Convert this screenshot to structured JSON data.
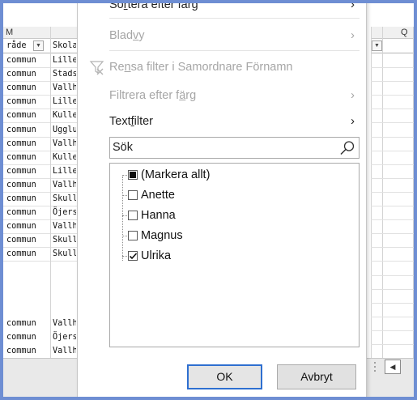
{
  "sheet": {
    "col_letters": {
      "left": "M",
      "right": "Q"
    },
    "header": {
      "col1": "råde",
      "col2": "Skola/"
    },
    "rows": [
      {
        "c1": "commun",
        "c2": "Lillegå"
      },
      {
        "c1": "commun",
        "c2": "Stadsp"
      },
      {
        "c1": "commun",
        "c2": "Vallha"
      },
      {
        "c1": "commun",
        "c2": "Lillegå"
      },
      {
        "c1": "commun",
        "c2": "Kulleg"
      },
      {
        "c1": "commun",
        "c2": "Ugglur"
      },
      {
        "c1": "commun",
        "c2": "Vallha"
      },
      {
        "c1": "commun",
        "c2": "Kulleg"
      },
      {
        "c1": "commun",
        "c2": "Lillegå"
      },
      {
        "c1": "commun",
        "c2": "Vallha"
      },
      {
        "c1": "commun",
        "c2": "Skulltc"
      },
      {
        "c1": "commun",
        "c2": "Öjersjo"
      },
      {
        "c1": "commun",
        "c2": "Vallha"
      },
      {
        "c1": "commun",
        "c2": "Skulltc"
      },
      {
        "c1": "commun",
        "c2": "Skulltc"
      }
    ],
    "bottom_rows": [
      {
        "c1": "commun",
        "c2": "Vallha"
      },
      {
        "c1": "commun",
        "c2": "Öjersjo"
      },
      {
        "c1": "commun",
        "c2": "Vallha"
      }
    ]
  },
  "menu": {
    "sort_by_color": {
      "pre": "So",
      "u": "r",
      "post": "tera efter färg"
    },
    "sheet_view": {
      "pre": "Blad",
      "u": "v",
      "post": "y"
    },
    "clear_filter": {
      "pre": "Re",
      "u": "n",
      "post": "sa filter i Samordnare Förnamn"
    },
    "filter_by_color": {
      "pre": "Filtrera efter f",
      "u": "ä",
      "post": "rg"
    },
    "text_filter": {
      "pre": "Text",
      "u": "f",
      "post": "ilter"
    },
    "chevron": "›"
  },
  "search": {
    "placeholder": "Sök"
  },
  "list_items": [
    {
      "label": "(Markera allt)",
      "state": "partial"
    },
    {
      "label": "Anette",
      "state": "unchecked"
    },
    {
      "label": "Hanna",
      "state": "unchecked"
    },
    {
      "label": "Magnus",
      "state": "unchecked"
    },
    {
      "label": "Ulrika",
      "state": "checked"
    }
  ],
  "buttons": {
    "ok": "OK",
    "cancel": "Avbryt"
  },
  "colors": {
    "accent": "#2e6fd0",
    "frame": "#6e8ed3",
    "disabled": "#a6a6a6"
  }
}
